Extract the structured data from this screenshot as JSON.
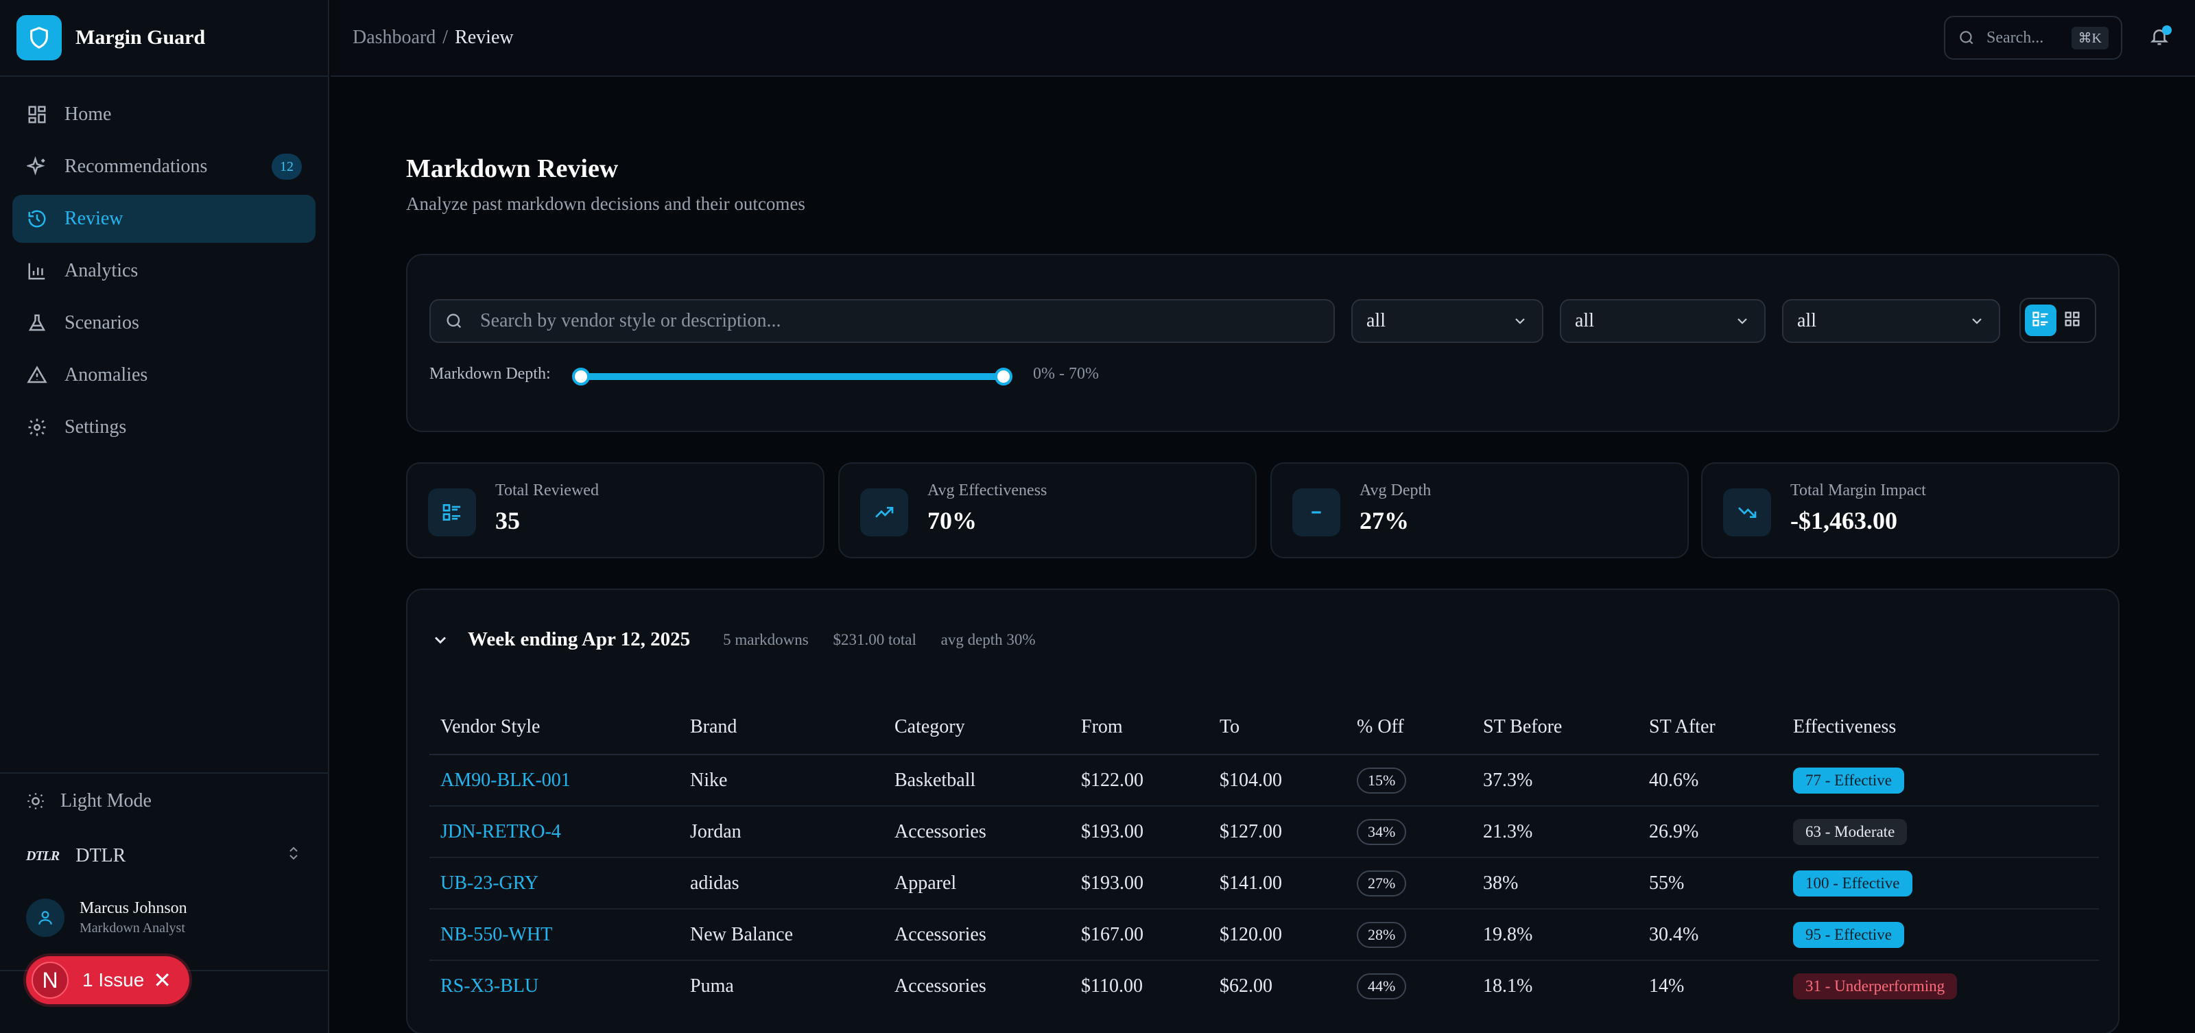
{
  "brand": {
    "name": "Margin Guard"
  },
  "nav": {
    "items": [
      {
        "label": "Home",
        "icon": "home-grid-icon"
      },
      {
        "label": "Recommendations",
        "icon": "sparkles-icon",
        "badge": "12"
      },
      {
        "label": "Review",
        "icon": "history-icon",
        "active": true
      },
      {
        "label": "Analytics",
        "icon": "bar-chart-icon"
      },
      {
        "label": "Scenarios",
        "icon": "flask-icon"
      },
      {
        "label": "Anomalies",
        "icon": "warning-icon"
      },
      {
        "label": "Settings",
        "icon": "gear-icon"
      }
    ]
  },
  "sidebar_bottom": {
    "theme_toggle": "Light Mode",
    "org_mark": "DTLR",
    "org_name": "DTLR",
    "user": {
      "name": "Marcus Johnson",
      "role": "Markdown Analyst"
    },
    "issue": {
      "initial": "N",
      "label": "1 Issue",
      "close": "✕"
    }
  },
  "topbar": {
    "breadcrumb": {
      "parent": "Dashboard",
      "separator": "/",
      "current": "Review"
    },
    "search": {
      "label": "Search...",
      "shortcut": "⌘K"
    }
  },
  "page": {
    "title": "Markdown Review",
    "subtitle": "Analyze past markdown decisions and their outcomes"
  },
  "filters": {
    "search_placeholder": "Search by vendor style or description...",
    "selects": [
      "all",
      "all",
      "all"
    ],
    "depth_label": "Markdown Depth:",
    "depth_range_text": "0% - 70%",
    "depth_min": 0,
    "depth_max": 70
  },
  "stats": [
    {
      "label": "Total Reviewed",
      "value": "35",
      "icon": "list-icon"
    },
    {
      "label": "Avg Effectiveness",
      "value": "70%",
      "icon": "trending-up-icon"
    },
    {
      "label": "Avg Depth",
      "value": "27%",
      "icon": "minus-icon"
    },
    {
      "label": "Total Margin Impact",
      "value": "-$1,463.00",
      "icon": "trending-down-icon"
    }
  ],
  "week": {
    "title": "Week ending Apr 12, 2025",
    "meta": {
      "count": "5 markdowns",
      "total": "$231.00 total",
      "depth": "avg depth 30%"
    },
    "columns": [
      "Vendor Style",
      "Brand",
      "Category",
      "From",
      "To",
      "% Off",
      "ST Before",
      "ST After",
      "Effectiveness"
    ],
    "rows": [
      {
        "style": "AM90-BLK-001",
        "brand": "Nike",
        "category": "Basketball",
        "from": "$122.00",
        "to": "$104.00",
        "off": "15%",
        "st_before": "37.3%",
        "st_after": "40.6%",
        "st_after_trend": "up",
        "effectiveness": "77 - Effective",
        "eff_level": "good"
      },
      {
        "style": "JDN-RETRO-4",
        "brand": "Jordan",
        "category": "Accessories",
        "from": "$193.00",
        "to": "$127.00",
        "off": "34%",
        "st_before": "21.3%",
        "st_after": "26.9%",
        "st_after_trend": "up",
        "effectiveness": "63 - Moderate",
        "eff_level": "mod"
      },
      {
        "style": "UB-23-GRY",
        "brand": "adidas",
        "category": "Apparel",
        "from": "$193.00",
        "to": "$141.00",
        "off": "27%",
        "st_before": "38%",
        "st_after": "55%",
        "st_after_trend": "up",
        "effectiveness": "100 - Effective",
        "eff_level": "good"
      },
      {
        "style": "NB-550-WHT",
        "brand": "New Balance",
        "category": "Accessories",
        "from": "$167.00",
        "to": "$120.00",
        "off": "28%",
        "st_before": "19.8%",
        "st_after": "30.4%",
        "st_after_trend": "up",
        "effectiveness": "95 - Effective",
        "eff_level": "good"
      },
      {
        "style": "RS-X3-BLU",
        "brand": "Puma",
        "category": "Accessories",
        "from": "$110.00",
        "to": "$62.00",
        "off": "44%",
        "st_before": "18.1%",
        "st_after": "14%",
        "st_after_trend": "down",
        "effectiveness": "31 - Underperforming",
        "eff_level": "bad"
      }
    ]
  },
  "colors": {
    "accent": "#13aee6",
    "positive": "#2ec07a",
    "negative": "#e23b51",
    "background": "#05080d"
  }
}
